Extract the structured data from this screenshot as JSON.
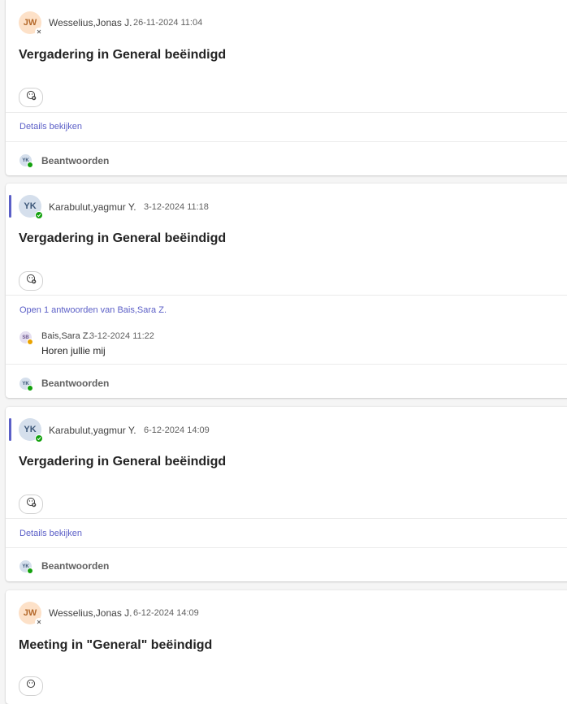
{
  "messages": [
    {
      "initials": "JW",
      "author": "Wesselius,Jonas J.",
      "time": "26-11-2024 11:04",
      "title": "Vergadering in General beëindigd",
      "link": "Details bekijken",
      "reply_initials": "YK",
      "reply_label": "Beantwoorden"
    },
    {
      "initials": "YK",
      "author": "Karabulut,yagmur Y.",
      "time": "3-12-2024 11:18",
      "title": "Vergadering in General beëindigd",
      "link": "Open 1 antwoorden van Bais,Sara Z.",
      "reply": {
        "initials": "SB",
        "author": "Bais,Sara Z.",
        "time": "3-12-2024 11:22",
        "text": "Horen jullie mij"
      },
      "reply_initials": "YK",
      "reply_label": "Beantwoorden"
    },
    {
      "initials": "YK",
      "author": "Karabulut,yagmur Y.",
      "time": "6-12-2024 14:09",
      "title": "Vergadering in General beëindigd",
      "link": "Details bekijken",
      "reply_initials": "YK",
      "reply_label": "Beantwoorden"
    },
    {
      "initials": "JW",
      "author": "Wesselius,Jonas J.",
      "time": "6-12-2024 14:09",
      "title": "Meeting in \"General\" beëindigd"
    }
  ]
}
